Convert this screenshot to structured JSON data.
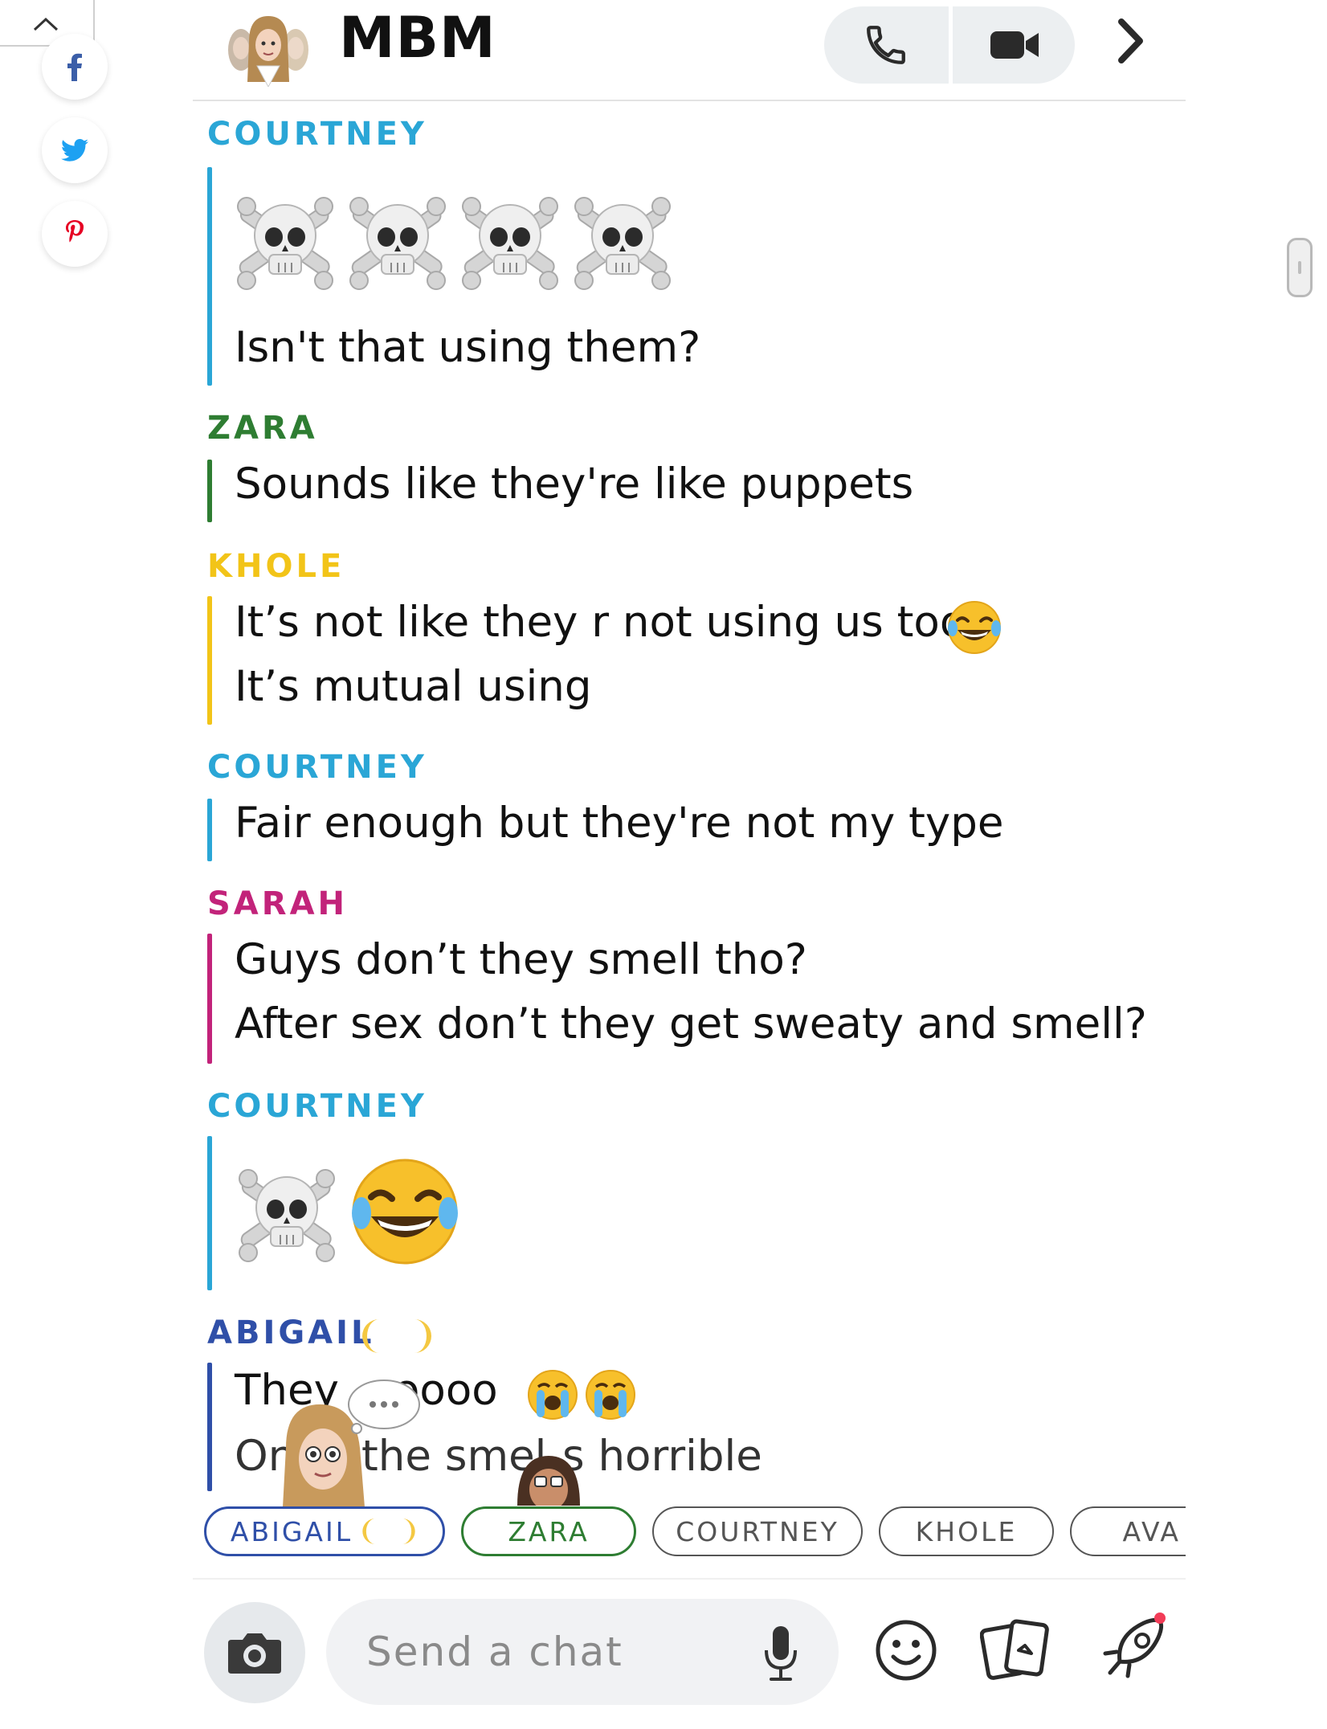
{
  "header": {
    "title": "MBM"
  },
  "messages": [
    {
      "sender": "COURTNEY",
      "color": "#2aa6d6",
      "lines": [
        "Isn't that using them?"
      ],
      "emoji": "skull-crossbones x4"
    },
    {
      "sender": "ZARA",
      "color": "#2e7d32",
      "lines": [
        "Sounds like they're like puppets"
      ]
    },
    {
      "sender": "KHOLE",
      "color": "#f2c418",
      "lines": [
        "It’s not like they r not using us too",
        "It’s mutual using"
      ],
      "emoji": "face-with-tears-of-joy"
    },
    {
      "sender": "COURTNEY",
      "color": "#2aa6d6",
      "lines": [
        "Fair enough but they're not my type"
      ]
    },
    {
      "sender": "SARAH",
      "color": "#c2237a",
      "lines": [
        "Guys don’t they smell tho?",
        "After sex don’t they get sweaty and smell?"
      ]
    },
    {
      "sender": "COURTNEY",
      "color": "#2aa6d6",
      "lines": [],
      "emoji": "skull-crossbones, face-with-tears-of-joy"
    },
    {
      "sender": "ABIGAIL",
      "color": "#2f4fa8",
      "lines": [
        "They",
        "oooo",
        "On",
        "the smel",
        "s horrible"
      ],
      "emoji": "moon-faces, loudly-crying x2"
    }
  ],
  "participants": [
    {
      "name": "ABIGAIL",
      "color": "#2f4fa8"
    },
    {
      "name": "ZARA",
      "color": "#2e7d32"
    },
    {
      "name": "COURTNEY",
      "color": "#555555"
    },
    {
      "name": "KHOLE",
      "color": "#555555"
    },
    {
      "name": "AVA",
      "color": "#555555"
    }
  ],
  "composer": {
    "placeholder": "Send a chat"
  },
  "icons": [
    "collapse-chevron-icon",
    "facebook-icon",
    "twitter-icon",
    "pinterest-icon",
    "phone-icon",
    "video-camera-icon",
    "chevron-right-icon",
    "camera-icon",
    "microphone-icon",
    "emoji-face-icon",
    "cards-icon",
    "rocket-icon"
  ]
}
